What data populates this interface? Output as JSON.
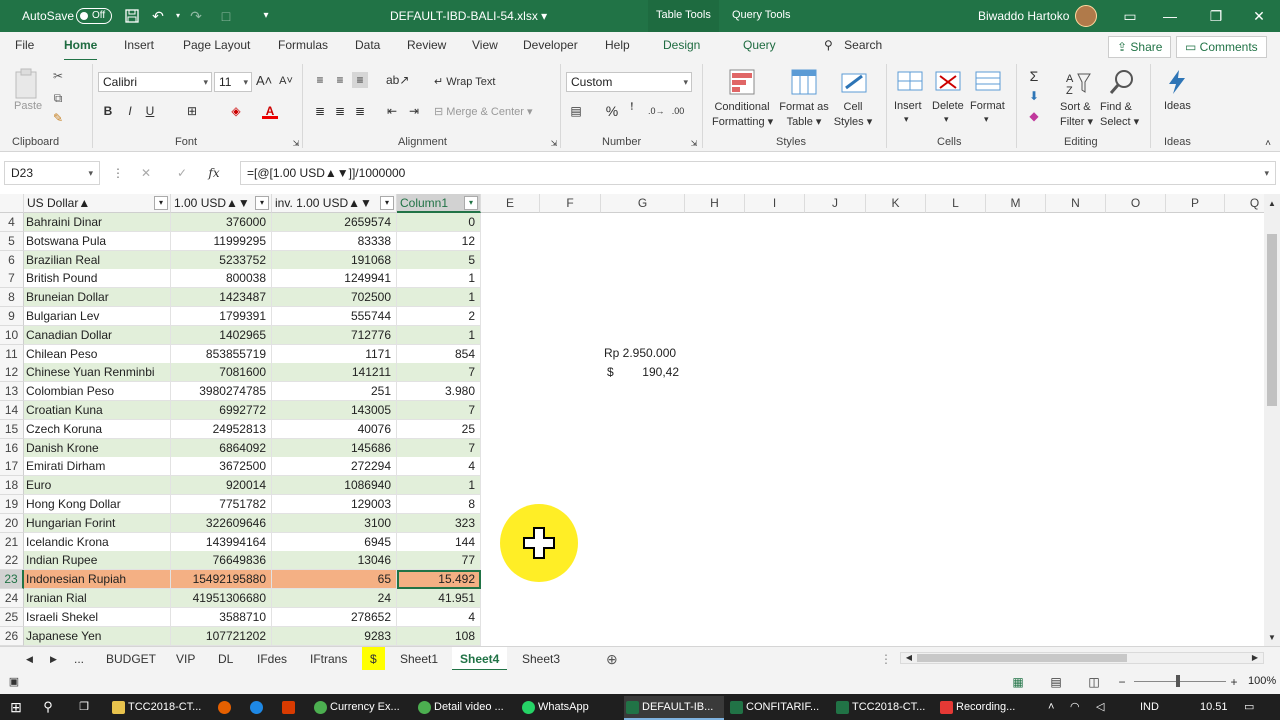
{
  "titlebar": {
    "autosave_label": "AutoSave",
    "autosave_state": "Off",
    "filename": "DEFAULT-IBD-BALI-54.xlsx",
    "context_tabs": [
      "Table Tools",
      "Query Tools"
    ],
    "user": "Biwaddo Hartoko"
  },
  "ribbon_tabs": [
    "File",
    "Home",
    "Insert",
    "Page Layout",
    "Formulas",
    "Data",
    "Review",
    "View",
    "Developer",
    "Help",
    "Design",
    "Query"
  ],
  "search_label": "Search",
  "share_label": "Share",
  "comments_label": "Comments",
  "ribbon": {
    "clipboard": {
      "paste": "Paste",
      "label": "Clipboard"
    },
    "font": {
      "name": "Calibri",
      "size": "11",
      "label": "Font",
      "bold": "B",
      "italic": "I",
      "underline": "U"
    },
    "alignment": {
      "wrap_text": "Wrap Text",
      "merge_center": "Merge & Center",
      "label": "Alignment"
    },
    "number": {
      "format": "Custom",
      "label": "Number"
    },
    "styles": {
      "conditional": [
        "Conditional",
        "Formatting"
      ],
      "format_table": [
        "Format as",
        "Table"
      ],
      "cell_styles": [
        "Cell",
        "Styles"
      ],
      "label": "Styles"
    },
    "cells": {
      "insert": "Insert",
      "delete": "Delete",
      "format": "Format",
      "label": "Cells"
    },
    "editing": {
      "sort_filter": [
        "Sort &",
        "Filter"
      ],
      "find_select": [
        "Find &",
        "Select"
      ],
      "label": "Editing"
    },
    "ideas": {
      "ideas": "Ideas",
      "label": "Ideas"
    }
  },
  "formula_bar": {
    "name_box": "D23",
    "fx": "fx",
    "formula": "=[@[1.00 USD▲▼]]/1000000"
  },
  "columns": {
    "table_headers": [
      "US Dollar▲",
      "1.00 USD▲▼",
      "inv. 1.00 USD▲▼",
      "Column1"
    ],
    "letters": [
      "E",
      "F",
      "G",
      "H",
      "I",
      "J",
      "K",
      "L",
      "M",
      "N",
      "O",
      "P",
      "Q"
    ]
  },
  "rows": [
    {
      "n": "4",
      "name": "Bahraini Dinar",
      "usd": "376000",
      "inv": "2659574",
      "c1": "0"
    },
    {
      "n": "5",
      "name": "Botswana Pula",
      "usd": "11999295",
      "inv": "83338",
      "c1": "12"
    },
    {
      "n": "6",
      "name": "Brazilian Real",
      "usd": "5233752",
      "inv": "191068",
      "c1": "5"
    },
    {
      "n": "7",
      "name": "British Pound",
      "usd": "800038",
      "inv": "1249941",
      "c1": "1"
    },
    {
      "n": "8",
      "name": "Bruneian Dollar",
      "usd": "1423487",
      "inv": "702500",
      "c1": "1"
    },
    {
      "n": "9",
      "name": "Bulgarian Lev",
      "usd": "1799391",
      "inv": "555744",
      "c1": "2"
    },
    {
      "n": "10",
      "name": "Canadian Dollar",
      "usd": "1402965",
      "inv": "712776",
      "c1": "1"
    },
    {
      "n": "11",
      "name": "Chilean Peso",
      "usd": "853855719",
      "inv": "1171",
      "c1": "854"
    },
    {
      "n": "12",
      "name": "Chinese Yuan Renminbi",
      "usd": "7081600",
      "inv": "141211",
      "c1": "7"
    },
    {
      "n": "13",
      "name": "Colombian Peso",
      "usd": "3980274785",
      "inv": "251",
      "c1": "3.980"
    },
    {
      "n": "14",
      "name": "Croatian Kuna",
      "usd": "6992772",
      "inv": "143005",
      "c1": "7"
    },
    {
      "n": "15",
      "name": "Czech Koruna",
      "usd": "24952813",
      "inv": "40076",
      "c1": "25"
    },
    {
      "n": "16",
      "name": "Danish Krone",
      "usd": "6864092",
      "inv": "145686",
      "c1": "7"
    },
    {
      "n": "17",
      "name": "Emirati Dirham",
      "usd": "3672500",
      "inv": "272294",
      "c1": "4"
    },
    {
      "n": "18",
      "name": "Euro",
      "usd": "920014",
      "inv": "1086940",
      "c1": "1"
    },
    {
      "n": "19",
      "name": "Hong Kong Dollar",
      "usd": "7751782",
      "inv": "129003",
      "c1": "8"
    },
    {
      "n": "20",
      "name": "Hungarian Forint",
      "usd": "322609646",
      "inv": "3100",
      "c1": "323"
    },
    {
      "n": "21",
      "name": "Icelandic Krona",
      "usd": "143994164",
      "inv": "6945",
      "c1": "144"
    },
    {
      "n": "22",
      "name": "Indian Rupee",
      "usd": "76649836",
      "inv": "13046",
      "c1": "77"
    },
    {
      "n": "23",
      "name": "Indonesian Rupiah",
      "usd": "15492195880",
      "inv": "65",
      "c1": "15.492"
    },
    {
      "n": "24",
      "name": "Iranian Rial",
      "usd": "41951306680",
      "inv": "24",
      "c1": "41.951"
    },
    {
      "n": "25",
      "name": "Israeli Shekel",
      "usd": "3588710",
      "inv": "278652",
      "c1": "4"
    },
    {
      "n": "26",
      "name": "Japanese Yen",
      "usd": "107721202",
      "inv": "9283",
      "c1": "108"
    }
  ],
  "side_values": {
    "g11": "Rp 2.950.000",
    "g12_symbol": "$",
    "g12_value": "190,42"
  },
  "sheet_tabs": [
    "...",
    "BUDGET",
    "VIP",
    "DL",
    "IFdes",
    "IFtrans",
    "$",
    "Sheet1",
    "Sheet4",
    "Sheet3"
  ],
  "active_sheet": "Sheet4",
  "zoom": "100%",
  "taskbar": {
    "items": [
      "TCC2018-CT...",
      "Currency Ex...",
      "Detail video ...",
      "WhatsApp",
      "DEFAULT-IB...",
      "CONFITARIF...",
      "TCC2018-CT...",
      "Recording..."
    ],
    "lang": "IND",
    "time": "10.51"
  },
  "colors": {
    "excel_green": "#217346",
    "table_band": "#e2efda",
    "highlight_row": "#f4b084",
    "yellow_tab": "#ffff00"
  }
}
